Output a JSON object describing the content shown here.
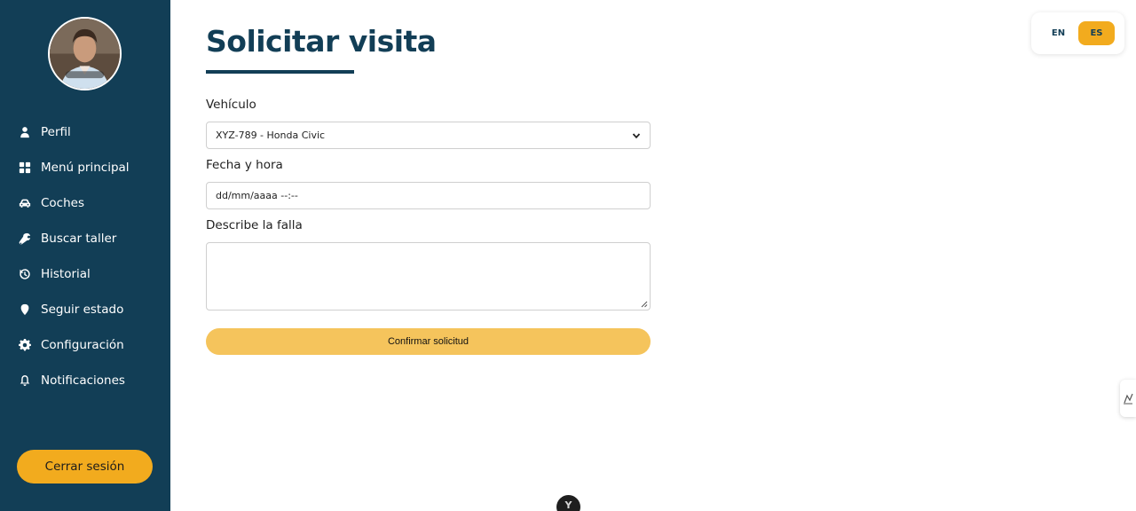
{
  "sidebar": {
    "items": [
      {
        "label": "Perfil",
        "icon": "user-icon"
      },
      {
        "label": "Menú principal",
        "icon": "grid-icon"
      },
      {
        "label": "Coches",
        "icon": "car-icon"
      },
      {
        "label": "Buscar taller",
        "icon": "wrench-icon"
      },
      {
        "label": "Historial",
        "icon": "history-icon"
      },
      {
        "label": "Seguir estado",
        "icon": "location-pin-icon"
      },
      {
        "label": "Configuración",
        "icon": "gear-icon"
      },
      {
        "label": "Notificaciones",
        "icon": "bell-icon"
      }
    ],
    "logout_label": "Cerrar sesión"
  },
  "main": {
    "title": "Solicitar visita",
    "vehicle_label": "Vehículo",
    "vehicle_value": "XYZ-789 - Honda Civic",
    "datetime_label": "Fecha y hora",
    "datetime_value": "dd/mm/aaaa --:--",
    "fault_label": "Describe la falla",
    "fault_value": "",
    "confirm_label": "Confirmar solicitud"
  },
  "lang": {
    "en_label": "EN",
    "es_label": "ES",
    "active": "ES"
  },
  "colors": {
    "sidebar_bg": "#123e56",
    "accent": "#f2ab1e",
    "confirm_bg": "#f5c45c"
  }
}
